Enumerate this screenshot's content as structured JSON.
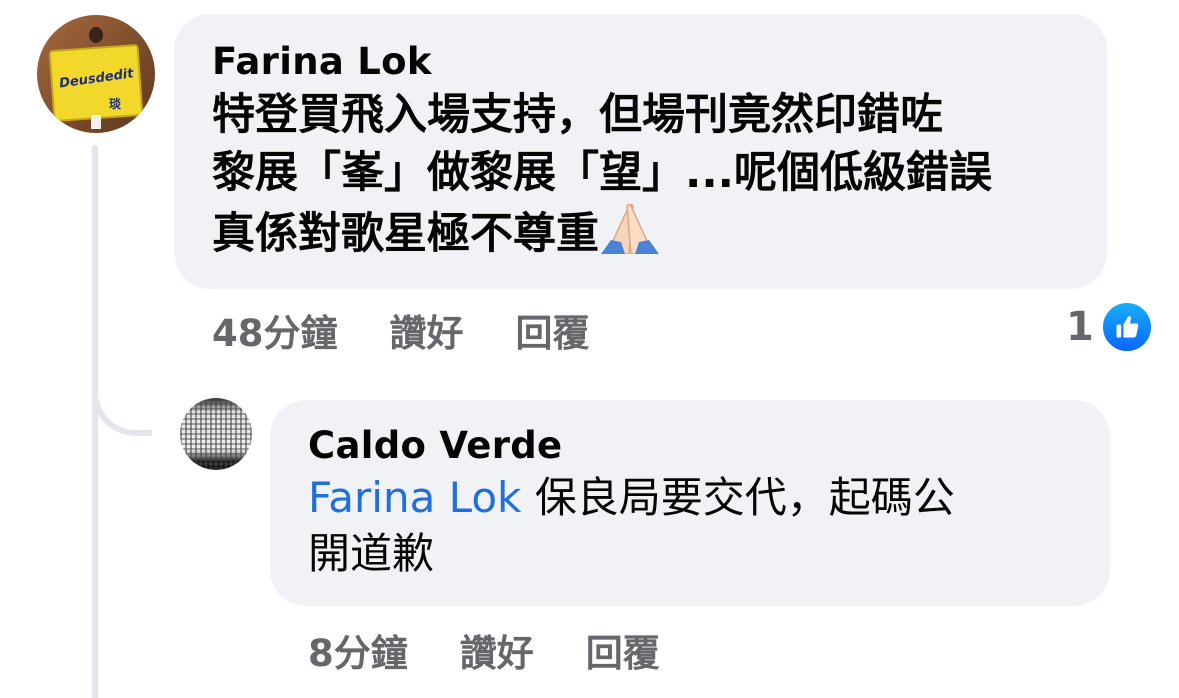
{
  "comment": {
    "author": "Farina Lok",
    "text_lines": [
      "特登買飛入場支持，但場刊竟然印錯咗",
      "黎展「峯」做黎展「望」...呢個低級錯誤",
      "真係對歌星極不尊重"
    ],
    "emoji": "folded-hands",
    "time": "48分鐘",
    "like_label": "讚好",
    "reply_label": "回覆",
    "reaction_count": "1",
    "avatar_text": "Deusdedit",
    "avatar_text_sub": "琰"
  },
  "reply": {
    "author": "Caldo Verde",
    "mention": "Farina Lok",
    "text_line1": " 保良局要交代，起碼公",
    "text_line2": "開道歉",
    "time": "8分鐘",
    "like_label": "讚好",
    "reply_label": "回覆"
  },
  "colors": {
    "bubble_bg": "#f0f2f5",
    "meta_text": "#65676b",
    "mention": "#216fdb",
    "like_blue": "#0866ff"
  }
}
